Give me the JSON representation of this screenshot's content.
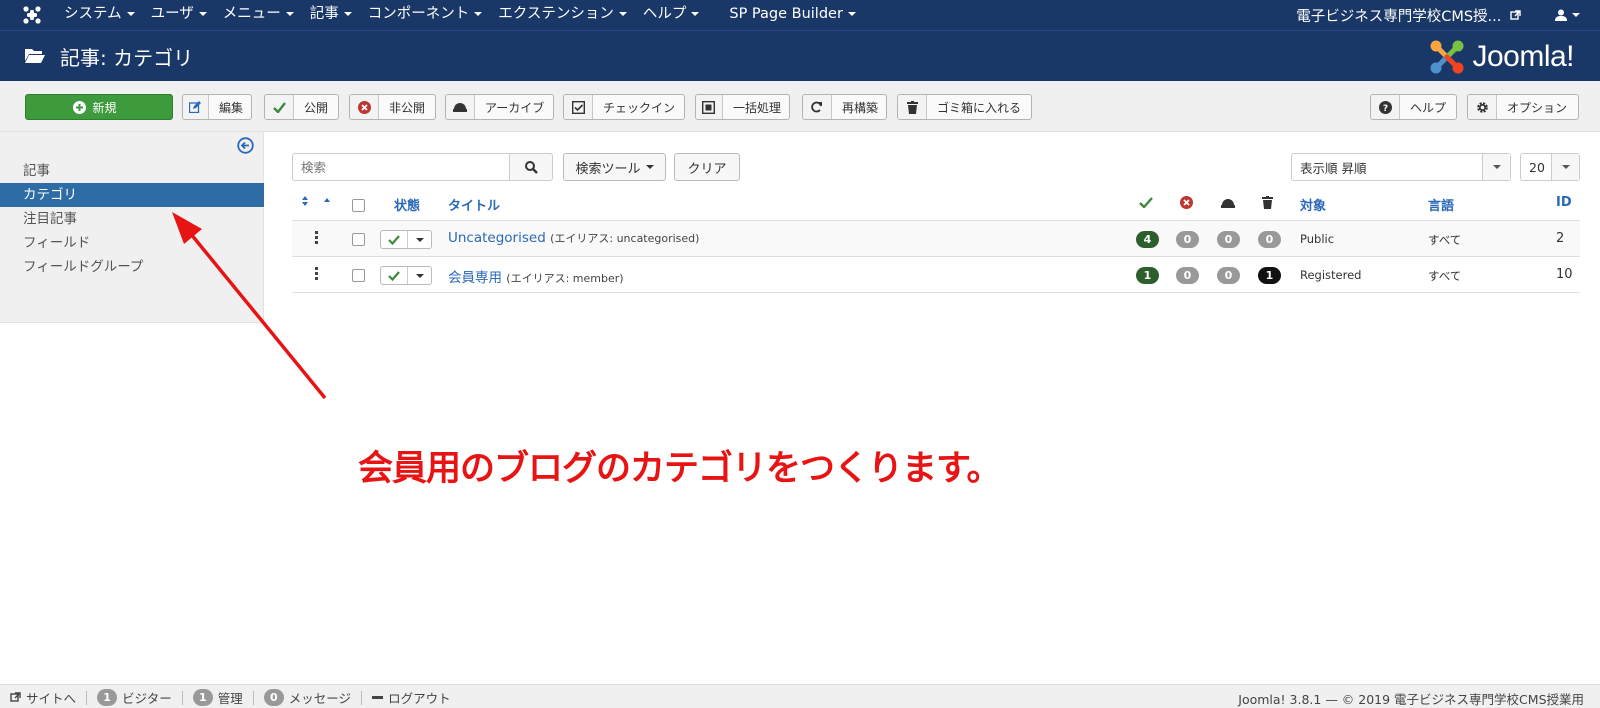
{
  "navbar": {
    "menu": [
      {
        "label": "システム"
      },
      {
        "label": "ユーザ"
      },
      {
        "label": "メニュー"
      },
      {
        "label": "記事"
      },
      {
        "label": "コンポーネント"
      },
      {
        "label": "エクステンション"
      },
      {
        "label": "ヘルプ"
      },
      {
        "label": "SP Page Builder"
      }
    ],
    "site_name": "電子ビジネス専門学校CMS授..."
  },
  "header": {
    "title": "記事: カテゴリ",
    "logo_text": "Joomla!"
  },
  "toolbar": {
    "new": "新規",
    "edit": "編集",
    "publish": "公開",
    "unpublish": "非公開",
    "archive": "アーカイブ",
    "checkin": "チェックイン",
    "batch": "一括処理",
    "rebuild": "再構築",
    "trash": "ゴミ箱に入れる",
    "help": "ヘルプ",
    "options": "オプション"
  },
  "sidebar": {
    "items": [
      {
        "label": "記事"
      },
      {
        "label": "カテゴリ"
      },
      {
        "label": "注目記事"
      },
      {
        "label": "フィールド"
      },
      {
        "label": "フィールドグループ"
      }
    ]
  },
  "filters": {
    "search_placeholder": "検索",
    "search_tools": "検索ツール",
    "clear": "クリア",
    "order": "表示順 昇順",
    "limit": "20"
  },
  "table": {
    "headers": {
      "status": "状態",
      "title": "タイトル",
      "access": "対象",
      "language": "言語",
      "id": "ID"
    },
    "rows": [
      {
        "title": "Uncategorised",
        "alias": "(エイリアス: uncategorised)",
        "published": "4",
        "unpublished": "0",
        "archived": "0",
        "trashed": "0",
        "access": "Public",
        "language": "すべて",
        "id": "2"
      },
      {
        "title": "会員専用",
        "alias": "(エイリアス: member)",
        "published": "1",
        "unpublished": "0",
        "archived": "0",
        "trashed": "1",
        "access": "Registered",
        "language": "すべて",
        "id": "10"
      }
    ]
  },
  "annotation": {
    "text": "会員用のブログのカテゴリをつくります。"
  },
  "footer": {
    "view_site": "サイトへ",
    "visitors_count": "1",
    "visitors": "ビジター",
    "admins_count": "1",
    "admins": "管理",
    "messages_count": "0",
    "messages": "メッセージ",
    "logout": "ログアウト",
    "version": "Joomla! 3.8.1 — © 2019 電子ビジネス専門学校CMS授業用"
  },
  "colors": {
    "navbar": "#1a3867",
    "accent": "#2d6ca5",
    "new_button": "#3d9a3d",
    "annotation": "#e81414"
  }
}
